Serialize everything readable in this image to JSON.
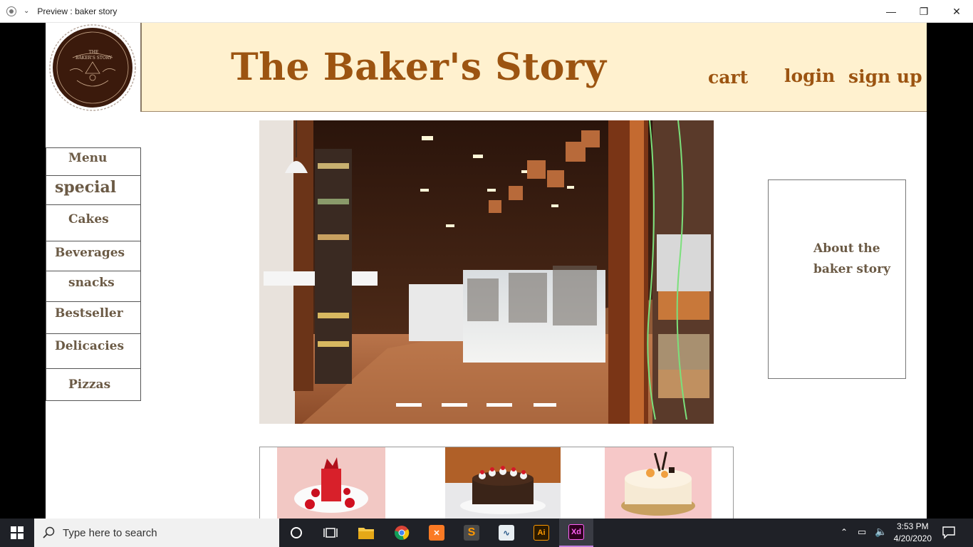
{
  "window": {
    "title": "Preview : baker story",
    "minimize_glyph": "—",
    "maximize_glyph": "❐",
    "close_glyph": "✕"
  },
  "header": {
    "site_title": "The Baker's Story",
    "logo_text_top": "THE",
    "logo_text_main": "BAKER'S STORY",
    "nav": {
      "cart": "cart",
      "login": "login",
      "signup": "sign up"
    }
  },
  "menu": [
    {
      "label": "Menu"
    },
    {
      "label": "special"
    },
    {
      "label": "Cakes"
    },
    {
      "label": "Beverages"
    },
    {
      "label": "snacks"
    },
    {
      "label": "Bestseller"
    },
    {
      "label": "Delicacies"
    },
    {
      "label": "Pizzas"
    }
  ],
  "carousel": {
    "slides": 4,
    "active_slide": 1
  },
  "about": {
    "text": "About the baker story"
  },
  "taskbar": {
    "search_placeholder": "Type here to search",
    "time": "3:53 PM",
    "date": "4/20/2020",
    "apps": [
      "cortana",
      "task-view",
      "file-explorer",
      "chrome",
      "xampp",
      "sublime-text",
      "inkscape",
      "illustrator",
      "adobe-xd"
    ],
    "illustrator_label": "Ai",
    "xd_label": "Xd"
  },
  "colors": {
    "header_bg": "#fff1cf",
    "brand_brown": "#9c5411",
    "menu_text": "#6b5a45",
    "logo_bg": "#3b1a0c"
  }
}
